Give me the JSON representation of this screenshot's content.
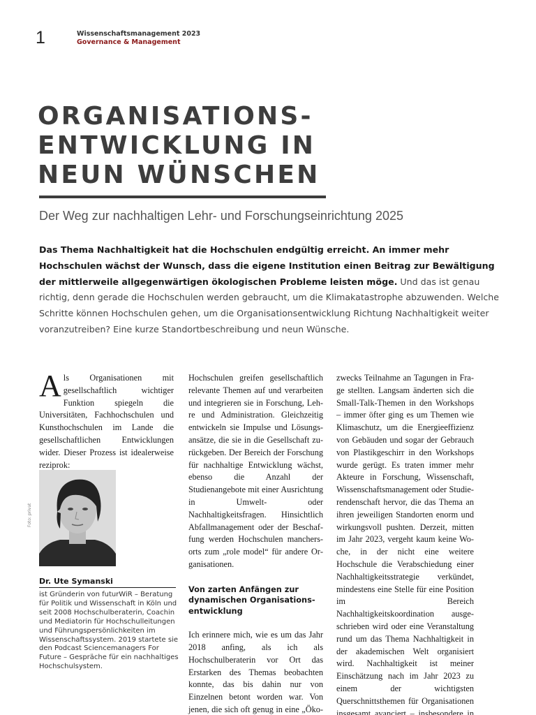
{
  "header": {
    "page_number": "1",
    "publication": "Wissenschaftsmanagement 2023",
    "section": "Governance & Management"
  },
  "article": {
    "title_lines": [
      "ORGANISATIONS-",
      "ENTWICKLUNG IN",
      "NEUN WÜNSCHEN"
    ],
    "subtitle": "Der Weg zur nachhaltigen Lehr- und Forschungseinrichtung 2025",
    "lead_bold": "Das Thema Nachhaltigkeit hat die Hochschulen endgültig erreicht. An immer mehr Hochschulen wächst der Wunsch, dass die eigene Institution einen Beitrag zur Bewältigung der mittlerweile allgegenwärtigen ökologischen Probleme leisten möge.",
    "lead_regular": " Und das ist genau richtig, denn gerade die Hochschulen werden gebraucht, um die Klimakatastrophe abzuwenden. Welche Schritte können Hochschulen gehen, um die Organisationsentwicklung Richtung Nachhaltigkeit weiter voranzutreiben? Eine kurze Standortbeschreibung und neun Wünsche.",
    "dropcap": "A",
    "col1_text": "ls Organisationen mit gesellschaft­lich wichtiger Funktion spiegeln die Universitäten, Fachhochschulen und Kunsthochschulen im Lande die gesellschaftlichen Entwicklungen wider. Dieser Prozess ist idealerweise reziprok:",
    "col2_text": "Hochschulen greifen gesellschaftlich relevante Themen auf und verarbeiten und integrieren sie in Forschung, Leh­re und Administration. Gleichzeitig entwickeln sie Impulse und Lösungs­ansätze, die sie in die Gesellschaft zu­rückgeben. Der Bereich der Forschung für nachhaltige Entwicklung wächst, ebenso die Anzahl der Studienangebote mit einer Ausrichtung in Umwelt- oder Nachhaltigkeitsfragen. Hinsichtlich Abfallmanagement oder der Beschaf­fung werden Hochschulen manchers­orts zum „role model“ für andere Or­ganisationen.",
    "subhead": "Von zarten Anfängen zur dynamischen Organisations­entwicklung",
    "col2_text_b": "Ich erinnere mich, wie es um das Jahr 2018 anfing, als ich als Hochschulbera­terin vor Ort das Erstarken des Themas beobachten konnte, das bis dahin nur von Einzelnen betont worden war. Von jenen, die sich oft genug in eine „Öko-Ecke“ gestellt sahen, wenn sie etwa die Menge an internationalen Flügen",
    "col3_text": "zwecks Teilnahme an Tagungen in Fra­ge stellten. Langsam änderten sich die Small-Talk-Themen in den Workshops – immer öfter ging es um Themen wie Klimaschutz, um die Energieeffizienz von Gebäuden und sogar der Gebrauch von Plastikgeschirr in den Workshops wurde gerügt. Es traten immer mehr Akteure in Forschung, Wissenschaft, Wissenschaftsmanagement oder Studie­rendenschaft hervor, die das Thema an ihren jeweiligen Standorten enorm und wirkungsvoll pushten. Derzeit, mitten im Jahr 2023, vergeht kaum keine Wo­che, in der nicht eine weitere Hochschu­le die Verabschiedung einer Nachhal­tigkeitsstrategie verkündet, mindestens eine Stelle für eine Position im Bereich Nachhaltigkeitskoordination ausge­schrieben wird oder eine Veranstaltung rund um das Thema Nachhaltigkeit in der akademischen Welt organisiert wird. Nachhaltigkeit ist meiner Einschätzung nach im Jahr 2023 zu einem der wich­tigsten Querschnittsthemen für Orga­nisationen insgesamt avanciert – ins­besondere in den Bereichen Forschung, Bildung und Wissenschaft."
  },
  "author": {
    "photo_credit": "Foto: privat",
    "name": "Dr. Ute Symanski",
    "bio": "ist Gründerin von futurWiR – Beratung für Politik und Wissen­schaft in Köln und seit 2008 Hochschulberaterin, Coachin und Mediatorin für Hochschulleitungen und Führungspersönlichkeiten im Wissenschaftssystem. 2019 startete sie den Podcast Sciencemanagers For Future – Gespräche für ein nachhaltiges Hochschulsystem."
  }
}
